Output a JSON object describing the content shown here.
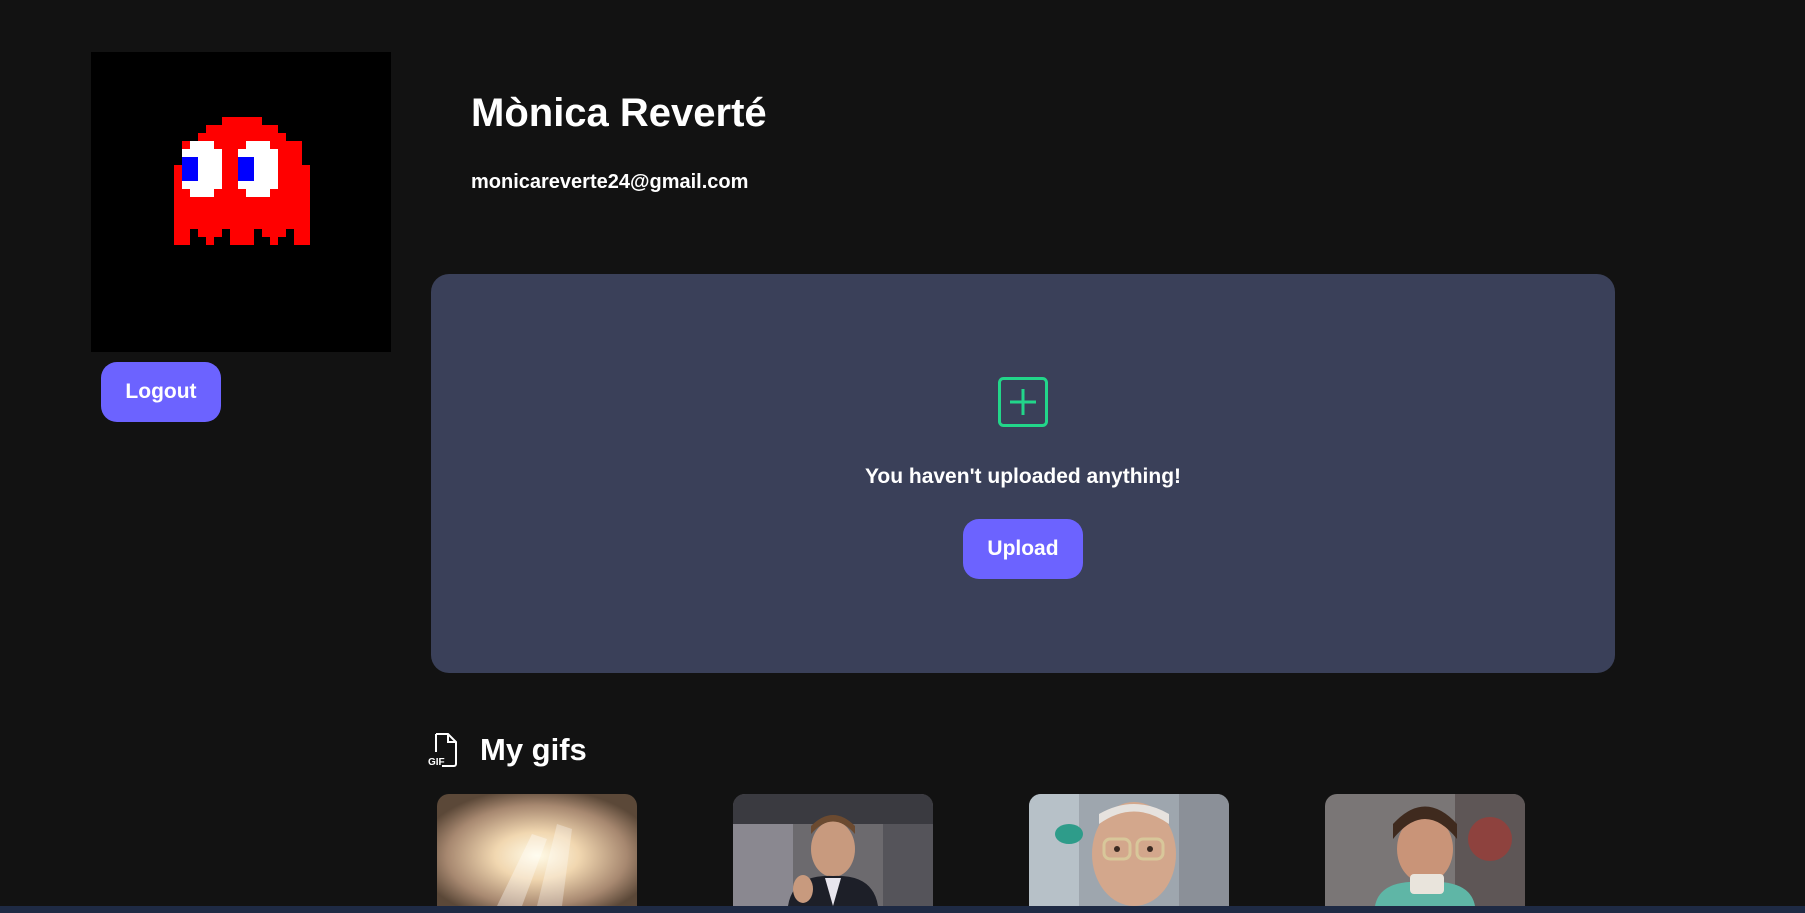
{
  "profile": {
    "name": "Mònica Reverté",
    "email": "monicareverte24@gmail.com",
    "avatar_icon": "pixel-ghost-icon",
    "logout_label": "Logout"
  },
  "upload_panel": {
    "icon": "plus-square-icon",
    "empty_message": "You haven't uploaded anything!",
    "upload_label": "Upload"
  },
  "gifs_section": {
    "icon": "gif-file-icon",
    "title": "My gifs",
    "thumbnail_count": 4
  },
  "colors": {
    "background": "#121212",
    "panel": "#3a4059",
    "accent": "#6c63ff",
    "plus_icon": "#22d68a"
  }
}
